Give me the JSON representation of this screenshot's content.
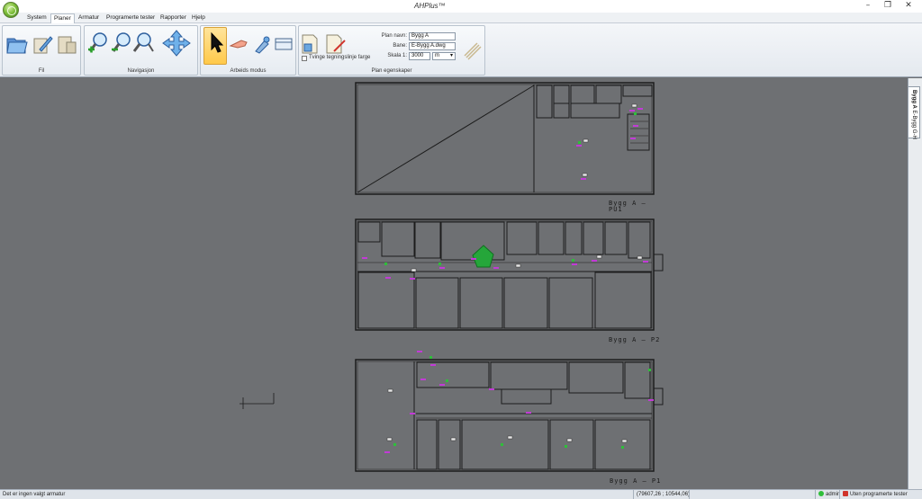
{
  "app": {
    "title": "AHPlus™"
  },
  "window": {
    "minimize": "–",
    "maximize": "❐",
    "close": "✕"
  },
  "menu": [
    "System",
    "Planer",
    "Armatur",
    "Programerte tester",
    "Rapporter",
    "Hjelp"
  ],
  "menu_active": "Planer",
  "ribbon": {
    "groups": {
      "fil": "Fil",
      "navigasjon": "Navigasjon",
      "arbeids_modus": "Arbeids modus",
      "plan_egenskaper": "Plan egenskaper"
    },
    "plan": {
      "navn_label": "Plan navn:",
      "navn_value": "Bygg A",
      "bane_label": "Bane:",
      "bane_value": "E-Bygg A.dwg",
      "skala_label": "Skala 1:",
      "skala_value": "3000",
      "unit_value": "m",
      "force_color_label": "Tvinge tegningslinje farge"
    },
    "icons": [
      "open-folder-icon",
      "pen-icon",
      "plan-tools-icon",
      "zoom-in-icon",
      "zoom-out-icon",
      "zoom-window-icon",
      "pan-arrows-icon",
      "select-pointer-icon",
      "hand-icon",
      "magnet-icon",
      "window-icon",
      "plan-edit-icon",
      "plan-color-icon",
      "dim-plan-icon"
    ]
  },
  "floors": [
    {
      "label": "Bygg  A  –  PU1"
    },
    {
      "label": "Bygg  A  –  P2"
    },
    {
      "label": "Bygg  A  –  P1"
    }
  ],
  "sidetab": {
    "bold": "Bygg A",
    "rest": " E-Bygg G-H"
  },
  "status": {
    "message": "Det er ingen valgt armatur",
    "coords": "(79607,26 ; 10544,06)",
    "user": "admin",
    "tests": "Uten programerte tester"
  },
  "colors": {
    "canvas": "#6e7073",
    "line": "#1c1c1c",
    "marker_magenta": "#c23bd6",
    "marker_green": "#2fbf3a",
    "selected_fixture": "#25a63a"
  }
}
